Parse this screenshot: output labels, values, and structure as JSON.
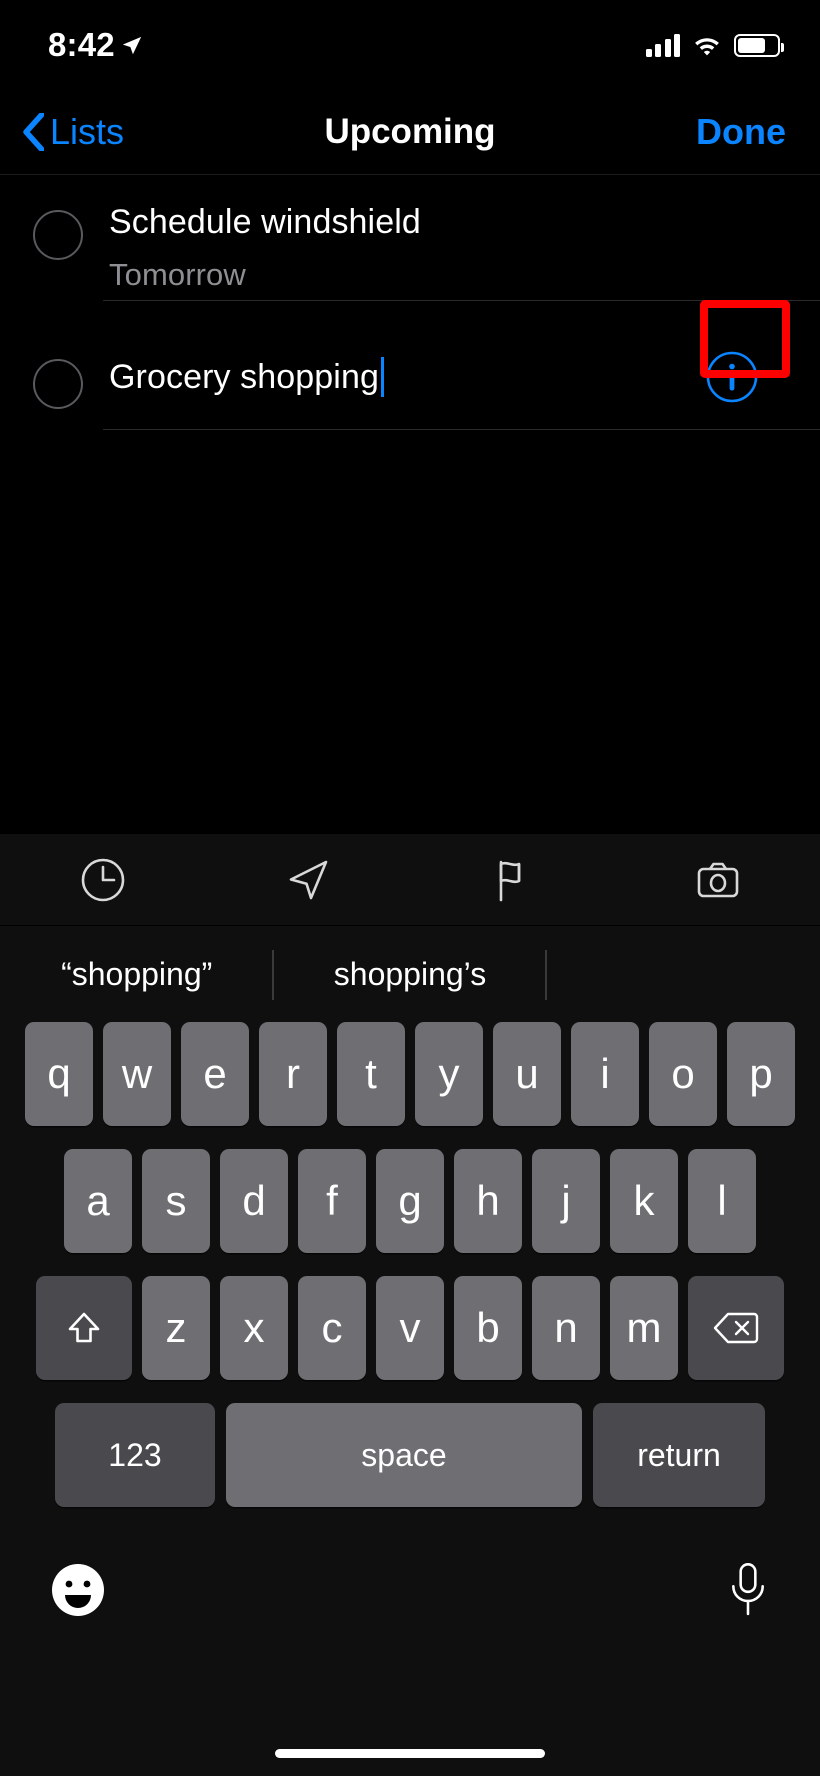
{
  "status_bar": {
    "time": "8:42",
    "location_icon": "location-arrow-icon",
    "cellular_icon": "cellular-signal-icon",
    "wifi_icon": "wifi-icon",
    "battery_icon": "battery-icon",
    "battery_level_pct": 70
  },
  "nav_bar": {
    "back_label": "Lists",
    "back_icon": "chevron-left-icon",
    "title": "Upcoming",
    "done_label": "Done",
    "accent_color": "#0a84ff"
  },
  "reminders": [
    {
      "title": "Schedule windshield",
      "subtitle": "Tomorrow",
      "completed": false,
      "editing": false
    },
    {
      "title": "Grocery shopping",
      "subtitle": "",
      "completed": false,
      "editing": true,
      "info_icon": "info-circle-icon"
    }
  ],
  "highlight": {
    "target": "info-circle-icon",
    "color": "#ff0000"
  },
  "keyboard": {
    "toolbar": [
      {
        "name": "clock-icon",
        "label": "Remind me at a time"
      },
      {
        "name": "location-arrow-icon",
        "label": "Remind me at a location"
      },
      {
        "name": "flag-icon",
        "label": "Flag"
      },
      {
        "name": "camera-icon",
        "label": "Add attachment"
      }
    ],
    "suggestions": [
      "“shopping”",
      "shopping’s",
      ""
    ],
    "rows": [
      [
        "q",
        "w",
        "e",
        "r",
        "t",
        "y",
        "u",
        "i",
        "o",
        "p"
      ],
      [
        "a",
        "s",
        "d",
        "f",
        "g",
        "h",
        "j",
        "k",
        "l"
      ],
      [
        "z",
        "x",
        "c",
        "v",
        "b",
        "n",
        "m"
      ]
    ],
    "shift_icon": "shift-up-arrow-icon",
    "delete_icon": "backspace-delete-icon",
    "numbers_label": "123",
    "space_label": "space",
    "return_label": "return",
    "emoji_icon": "emoji-smiley-icon",
    "dictation_icon": "microphone-icon"
  },
  "home_indicator": "home-indicator-bar"
}
